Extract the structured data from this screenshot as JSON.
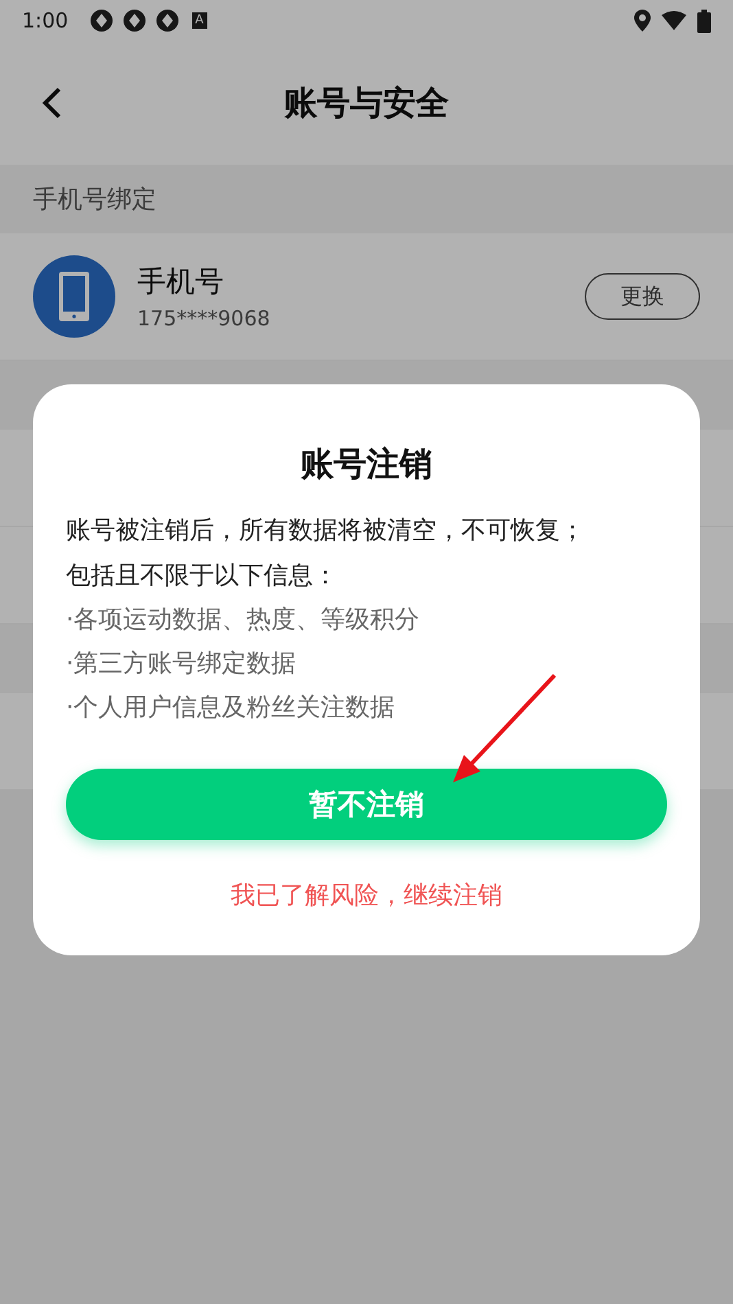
{
  "status_bar": {
    "time": "1:00",
    "notification_letter": "A"
  },
  "nav": {
    "title": "账号与安全"
  },
  "sections": [
    {
      "header": "手机号绑定",
      "rows": [
        {
          "kind": "phone",
          "name": "手机号",
          "value": "175****9068",
          "action": "更换"
        }
      ]
    },
    {
      "rows": [
        {
          "kind": "blank"
        },
        {
          "kind": "blank"
        }
      ]
    },
    {
      "rows": [
        {
          "kind": "blank"
        }
      ]
    }
  ],
  "dialog": {
    "title": "账号注销",
    "message_lines": [
      "账号被注销后，所有数据将被清空，不可恢复；",
      "包括且不限于以下信息："
    ],
    "items": [
      "·各项运动数据、热度、等级积分",
      "·第三方账号绑定数据",
      "·个人用户信息及粉丝关注数据"
    ],
    "primary_button": "暂不注销",
    "secondary_link": "我已了解风险，继续注销"
  }
}
